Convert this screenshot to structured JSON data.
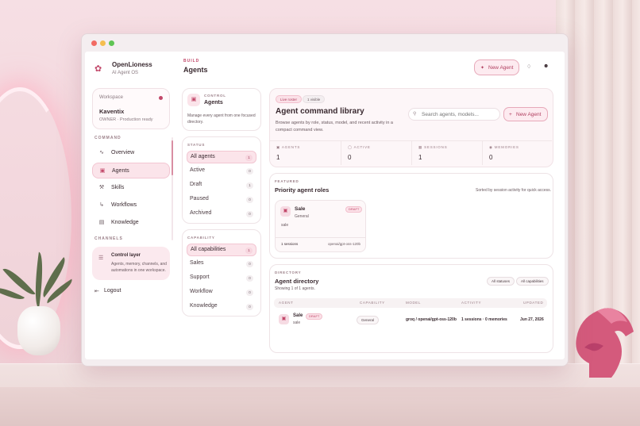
{
  "app": {
    "brand_name": "OpenLioness",
    "brand_sub": "AI Agent OS"
  },
  "workspace": {
    "label": "Workspace",
    "name": "Kaventix",
    "role": "OWNER · Production ready"
  },
  "sidebar": {
    "command_label": "COMMAND",
    "items": [
      {
        "label": "Overview",
        "icon": "pulse-icon"
      },
      {
        "label": "Agents",
        "icon": "robot-icon"
      },
      {
        "label": "Skills",
        "icon": "wrench-icon"
      },
      {
        "label": "Workflows",
        "icon": "flow-icon"
      },
      {
        "label": "Knowledge",
        "icon": "book-icon"
      }
    ],
    "channels_label": "CHANNELS",
    "control_layer": {
      "title": "Control layer",
      "desc": "Agents, memory, channels, and automations in one workspace."
    },
    "logout": "Logout"
  },
  "header": {
    "crumb": "BUILD",
    "title": "Agents",
    "new_agent": "New Agent"
  },
  "control": {
    "eyebrow": "CONTROL",
    "title": "Agents",
    "desc": "Manage every agent from one focused directory."
  },
  "status": {
    "label": "STATUS",
    "items": [
      {
        "label": "All agents",
        "count": "1"
      },
      {
        "label": "Active",
        "count": "0"
      },
      {
        "label": "Draft",
        "count": "1"
      },
      {
        "label": "Paused",
        "count": "0"
      },
      {
        "label": "Archived",
        "count": "0"
      }
    ]
  },
  "capability": {
    "label": "CAPABILITY",
    "items": [
      {
        "label": "All capabilities",
        "count": "1"
      },
      {
        "label": "Sales",
        "count": "0"
      },
      {
        "label": "Support",
        "count": "0"
      },
      {
        "label": "Workflow",
        "count": "0"
      },
      {
        "label": "Knowledge",
        "count": "0"
      }
    ]
  },
  "library": {
    "chip_live": "Live roster",
    "chip_visible": "1 visible",
    "title": "Agent command library",
    "desc": "Browse agents by role, status, model, and recent activity in a compact command view.",
    "search_placeholder": "Search agents, models...",
    "new_agent": "New Agent",
    "stats": [
      {
        "label": "AGENTS",
        "value": "1",
        "icon": "robot-icon"
      },
      {
        "label": "ACTIVE",
        "value": "0",
        "icon": "check-circle-icon"
      },
      {
        "label": "SESSIONS",
        "value": "1",
        "icon": "grid-icon"
      },
      {
        "label": "MEMORIES",
        "value": "0",
        "icon": "memory-icon"
      }
    ]
  },
  "featured": {
    "eyebrow": "FEATURED",
    "title": "Priority agent roles",
    "note": "Sorted by session activity for quick access.",
    "card": {
      "name": "Sale",
      "badge": "DRAFT",
      "capability": "General",
      "desc": "sale",
      "sessions": "1 sessions",
      "model": "openai/gpt-oss-120b"
    }
  },
  "directory": {
    "eyebrow": "DIRECTORY",
    "title": "Agent directory",
    "note": "Showing 1 of 1 agents.",
    "filter_status": "All statuses",
    "filter_cap": "All capabilities",
    "columns": [
      "AGENT",
      "CAPABILITY",
      "MODEL",
      "ACTIVITY",
      "UPDATED"
    ],
    "rows": [
      {
        "name": "Sale",
        "badge": "DRAFT",
        "desc": "sale",
        "capability": "General",
        "model": "groq / openai/gpt-oss-120b",
        "activity": "1 sessions · 0 memories",
        "updated": "Jun 27, 2026"
      }
    ]
  },
  "colors": {
    "accent": "#c2486a",
    "accent_soft": "#fbe4ea",
    "mac_red": "#f26b63",
    "mac_yellow": "#f5be4f",
    "mac_green": "#5fc454"
  }
}
